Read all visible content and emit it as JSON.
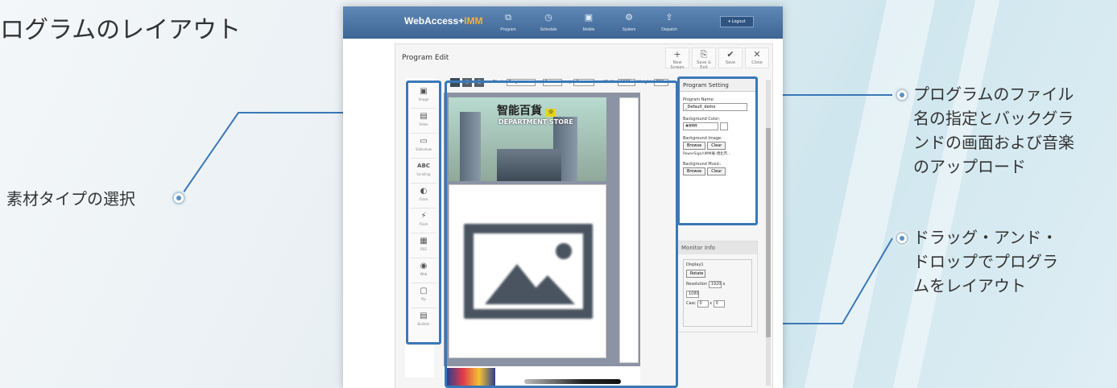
{
  "heading": "ログラムのレイアウト",
  "annotations": {
    "left_label": "素材タイプの選択",
    "right_top": [
      "プログラムのファイル",
      "名の指定とバックグラ",
      "ンドの画面および音楽",
      "のアップロード"
    ],
    "right_bottom": [
      "ドラッグ・アンド・",
      "ドロップでプログラ",
      "ムをレイアウト"
    ]
  },
  "app": {
    "logo_main": "WebAccess+",
    "logo_accent": "IMM",
    "nav": [
      {
        "label": "Program",
        "icon": "program-icon"
      },
      {
        "label": "Schedule",
        "icon": "schedule-icon"
      },
      {
        "label": "Mobile",
        "icon": "mobile-icon"
      },
      {
        "label": "System",
        "icon": "system-icon"
      },
      {
        "label": "Dispatch",
        "icon": "dispatch-icon"
      }
    ],
    "logout": "▾ Logout",
    "page_title": "Program Edit",
    "toolbar": [
      {
        "label": "New Screen",
        "glyph": "+"
      },
      {
        "label": "Save & Exit",
        "glyph": "⎘"
      },
      {
        "label": "Save",
        "glyph": "✔"
      },
      {
        "label": "Close",
        "glyph": "✕"
      }
    ],
    "tools": [
      {
        "label": "Image",
        "glyph": "▣"
      },
      {
        "label": "Video",
        "glyph": "▤"
      },
      {
        "label": "Slideshow",
        "glyph": "▭"
      },
      {
        "label": "Scrolling",
        "glyph": "ABC"
      },
      {
        "label": "Clock",
        "glyph": "◐"
      },
      {
        "label": "Flash",
        "glyph": "⚡"
      },
      {
        "label": "RSS",
        "glyph": "▦"
      },
      {
        "label": "Web",
        "glyph": "◉"
      },
      {
        "label": "Pip",
        "glyph": "▢"
      },
      {
        "label": "Bulletin",
        "glyph": "▤"
      }
    ],
    "blockbar": {
      "block_label": "Block",
      "block_value": "Program",
      "x_label": "x",
      "x_value": "0",
      "y_label": "y",
      "y_value": "0",
      "width_label": "Width",
      "width_value": "1366",
      "height_label": "Height",
      "height_value": "768"
    },
    "canvas": {
      "banner_title": "智能百貨",
      "banner_sub": "DEPARTMENT STORE"
    },
    "settings": {
      "title": "Program Setting",
      "name_label": "Program Name:",
      "name_value": "_Default_demo",
      "bgcolor_label": "Background Color:",
      "bgcolor_value": "#ffffff",
      "bgimage_label": "Background Image:",
      "browse": "Browse",
      "clear": "Clear",
      "bgimage_path": "PowerSign/\\IMM展-博北市...",
      "bgmusic_label": "Background Music:"
    },
    "monitor": {
      "title": "Monitor Info",
      "display_label": "Display1",
      "rotate": "Rotate",
      "resolution_label": "Resolution",
      "res_w": "1920",
      "res_h": "1080",
      "cascade_label": "Casc",
      "cascade_x": "0",
      "cascade_y": "0"
    }
  }
}
